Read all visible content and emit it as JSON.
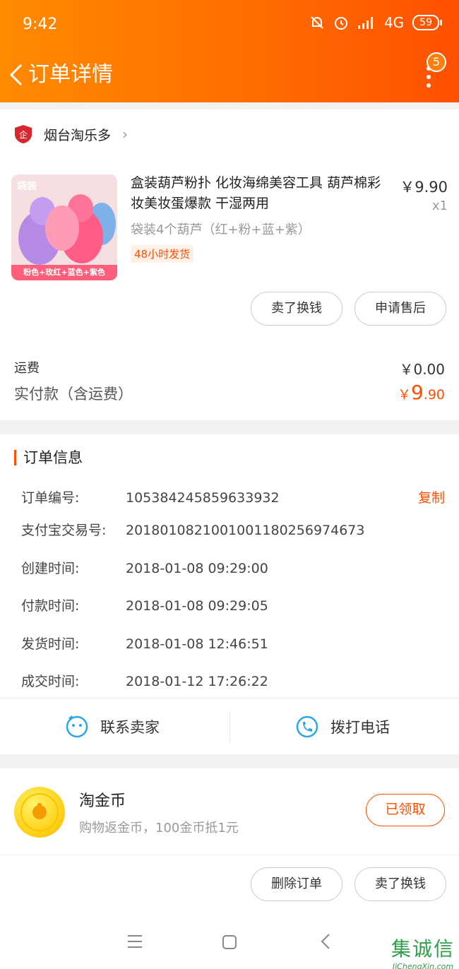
{
  "status_bar": {
    "time": "9:42",
    "network": "4G",
    "battery": "59"
  },
  "nav": {
    "title": "订单详情",
    "badge_count": "5"
  },
  "shop": {
    "name": "烟台淘乐多"
  },
  "product": {
    "title": "盒装葫芦粉扑 化妆海绵美容工具 葫芦棉彩妆美妆蛋爆款 干湿两用",
    "price": "￥9.90",
    "quantity": "x1",
    "sku": "袋装4个葫芦（红+粉+蓝+紫）",
    "ship_tag": "48小时发货",
    "thumb_tag": "袋装",
    "thumb_caption": "粉色+玫红+蓝色+紫色"
  },
  "item_actions": {
    "sell": "卖了换钱",
    "aftersale": "申请售后"
  },
  "fees": {
    "shipping_label": "运费",
    "shipping_value": "￥0.00",
    "paid_label": "实付款（含运费）",
    "paid_currency": "￥",
    "paid_int": "9",
    "paid_dec": ".90"
  },
  "order_info": {
    "title": "订单信息",
    "copy_label": "复制",
    "rows": [
      {
        "label": "订单编号:",
        "value": "105384245859633932"
      },
      {
        "label": "支付宝交易号:",
        "value": "2018010821001001180256974673"
      },
      {
        "label": "创建时间:",
        "value": "2018-01-08 09:29:00"
      },
      {
        "label": "付款时间:",
        "value": "2018-01-08 09:29:05"
      },
      {
        "label": "发货时间:",
        "value": "2018-01-08 12:46:51"
      },
      {
        "label": "成交时间:",
        "value": "2018-01-12 17:26:22"
      }
    ]
  },
  "contact": {
    "seller": "联系卖家",
    "phone": "拨打电话"
  },
  "coins": {
    "title": "淘金币",
    "desc": "购物返金币，100金币抵1元",
    "button": "已领取"
  },
  "footer_actions": {
    "delete": "删除订单",
    "sell": "卖了换钱"
  },
  "watermark": {
    "cn": "集诚信",
    "en": "JiChengXin.com"
  },
  "colors": {
    "accent": "#ff5000",
    "header_start": "#ff8a00",
    "header_end": "#ff5000"
  }
}
